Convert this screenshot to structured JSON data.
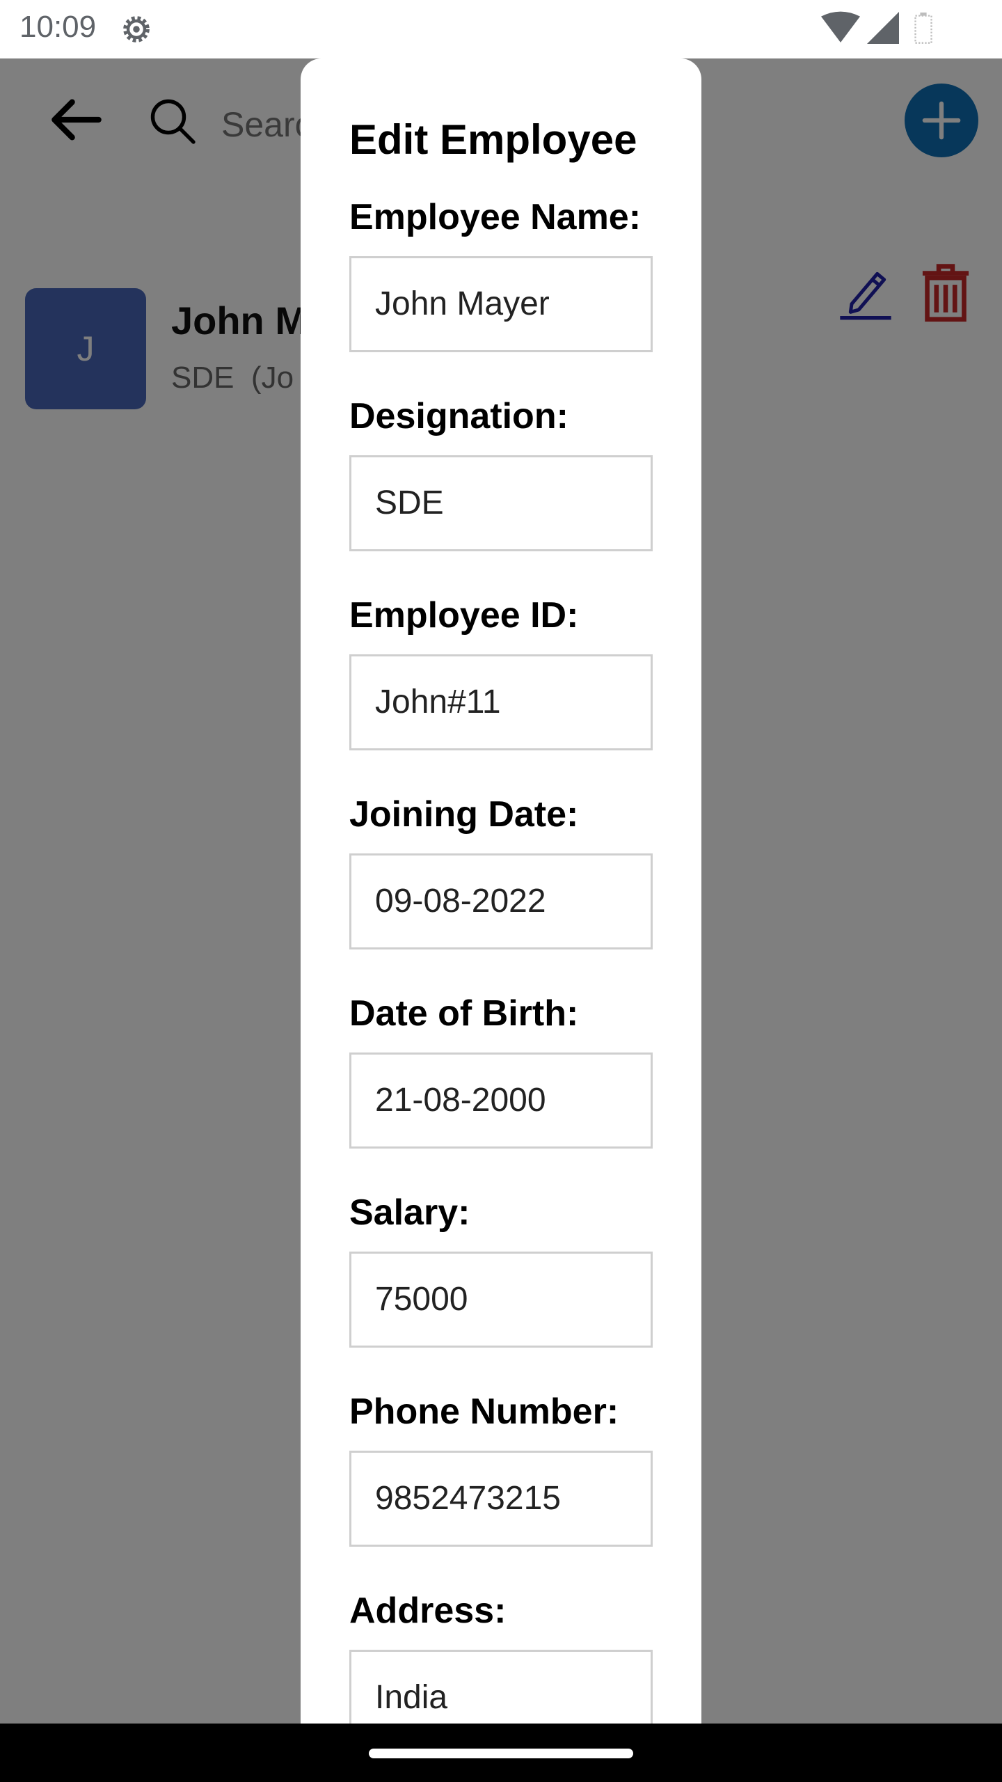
{
  "status_bar": {
    "time": "10:09",
    "icons": [
      "settings-gear-icon",
      "wifi-icon",
      "cellular-signal-icon",
      "battery-icon"
    ]
  },
  "background_app": {
    "search_placeholder": "Searc",
    "employee": {
      "avatar_letter": "J",
      "name": "John M",
      "subtitle": "SDE  (Jo"
    },
    "colors": {
      "fab": "#0e6fb5",
      "avatar": "#4867b8",
      "edit_icon": "#2020a8",
      "delete_icon": "#c62828"
    }
  },
  "dialog": {
    "title": "Edit Employee",
    "fields": [
      {
        "label": "Employee Name:",
        "value": "John Mayer"
      },
      {
        "label": "Designation:",
        "value": "SDE"
      },
      {
        "label": "Employee ID:",
        "value": "John#11"
      },
      {
        "label": "Joining Date:",
        "value": "09-08-2022"
      },
      {
        "label": "Date of Birth:",
        "value": "21-08-2000"
      },
      {
        "label": "Salary:",
        "value": "75000"
      },
      {
        "label": "Phone Number:",
        "value": "9852473215"
      },
      {
        "label": "Address:",
        "value": "India"
      }
    ]
  }
}
